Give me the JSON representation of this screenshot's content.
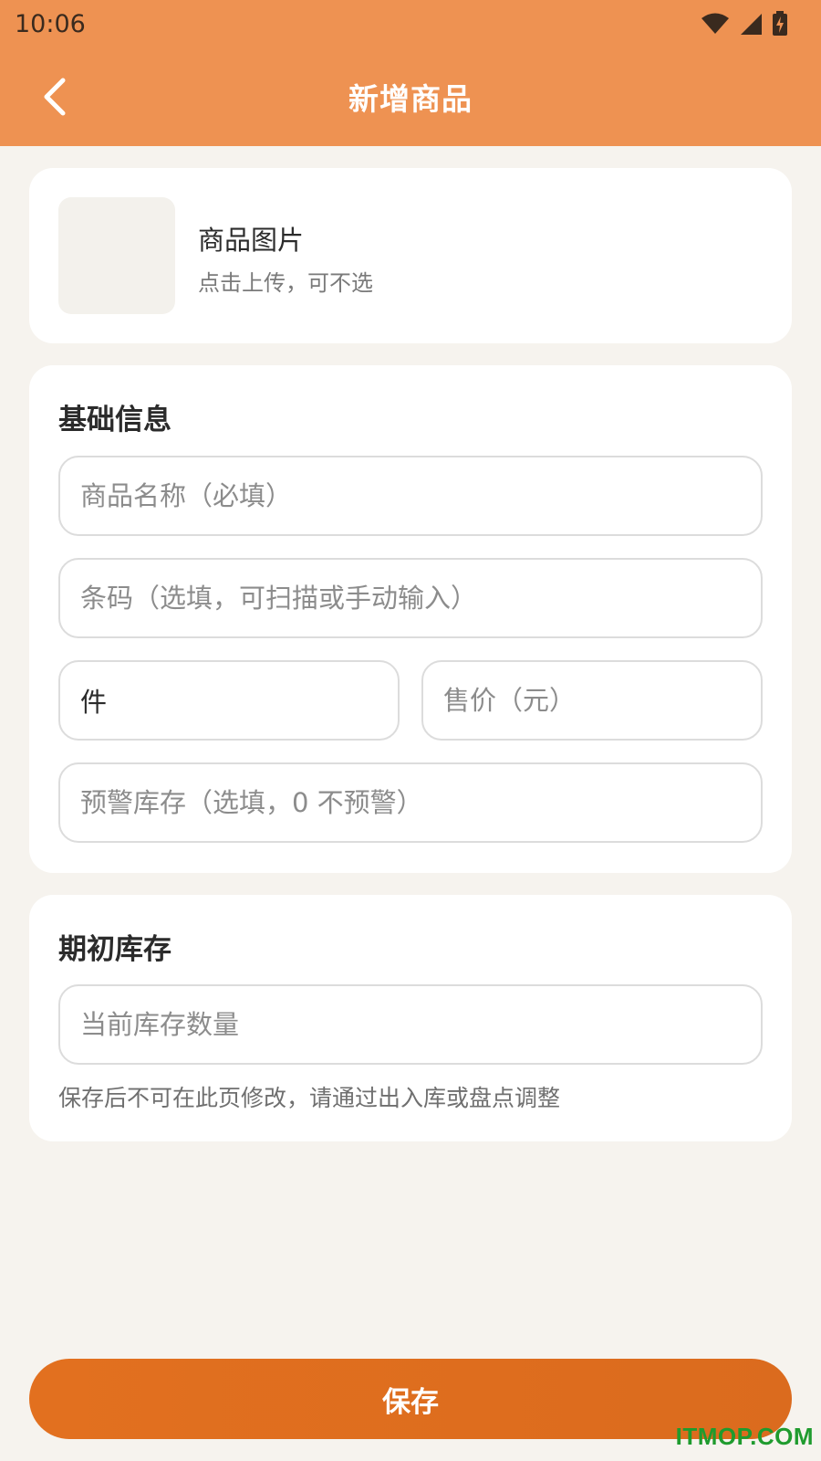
{
  "status_bar": {
    "time": "10:06"
  },
  "header": {
    "title": "新增商品"
  },
  "image_card": {
    "title": "商品图片",
    "subtitle": "点击上传，可不选"
  },
  "basic_info": {
    "title": "基础信息",
    "name_placeholder": "商品名称（必填）",
    "barcode_placeholder": "条码（选填，可扫描或手动输入）",
    "unit_value": "件",
    "price_placeholder": "售价（元）",
    "alert_stock_placeholder": "预警库存（选填，0 不预警）"
  },
  "initial_stock": {
    "title": "期初库存",
    "quantity_placeholder": "当前库存数量",
    "hint": "保存后不可在此页修改，请通过出入库或盘点调整"
  },
  "save_label": "保存",
  "watermark": "ITMOP.COM",
  "colors": {
    "header": "#ee9252",
    "accent": "#e2701f",
    "background": "#f6f3ee"
  }
}
